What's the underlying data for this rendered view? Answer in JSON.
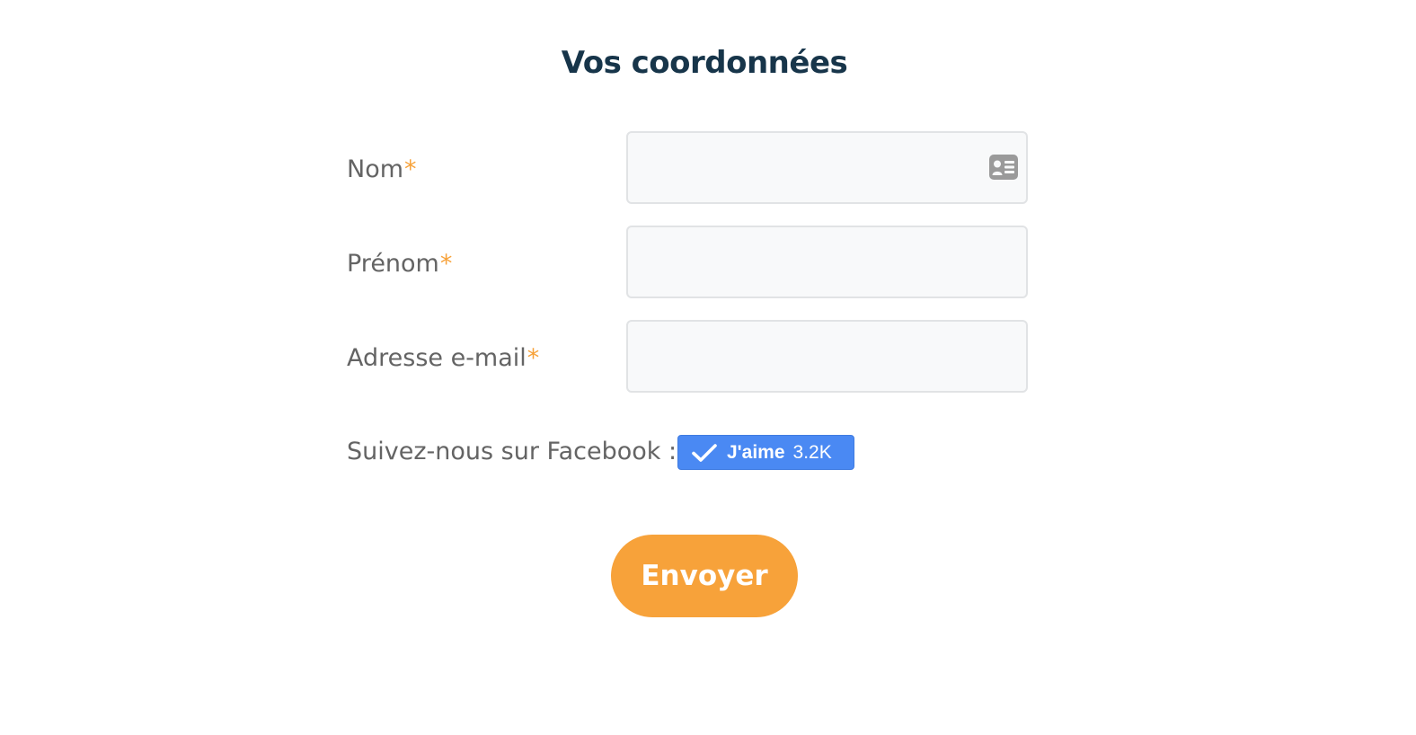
{
  "form": {
    "title": "Vos coordonnées",
    "required_marker": "*",
    "fields": [
      {
        "label": "Nom",
        "value": "",
        "placeholder": ""
      },
      {
        "label": "Prénom",
        "value": "",
        "placeholder": ""
      },
      {
        "label": "Adresse e-mail",
        "value": "",
        "placeholder": ""
      }
    ],
    "facebook": {
      "label": "Suivez-nous sur Facebook :",
      "button_label": "J'aime",
      "count": "3.2K"
    },
    "submit_label": "Envoyer"
  },
  "icons": {
    "contact_card": "contact-card-icon",
    "check": "check-icon"
  },
  "colors": {
    "title": "#17354a",
    "label": "#646464",
    "accent": "#f7a23a",
    "facebook": "#4a89f3",
    "field_bg": "#f8f9fa",
    "field_border": "#e1e3e5"
  }
}
